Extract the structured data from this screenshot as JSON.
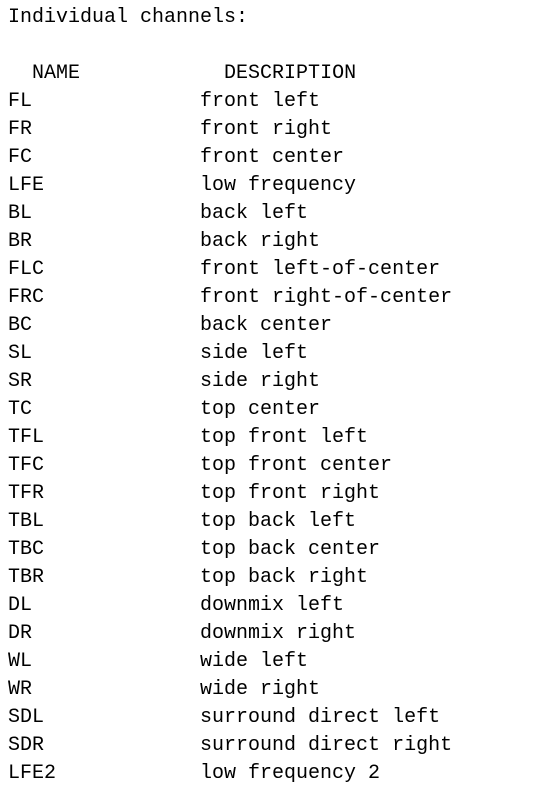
{
  "title": "Individual channels:",
  "header": {
    "name": "NAME",
    "description": "DESCRIPTION"
  },
  "channels": [
    {
      "name": "FL",
      "description": "front left"
    },
    {
      "name": "FR",
      "description": "front right"
    },
    {
      "name": "FC",
      "description": "front center"
    },
    {
      "name": "LFE",
      "description": "low frequency"
    },
    {
      "name": "BL",
      "description": "back left"
    },
    {
      "name": "BR",
      "description": "back right"
    },
    {
      "name": "FLC",
      "description": "front left-of-center"
    },
    {
      "name": "FRC",
      "description": "front right-of-center"
    },
    {
      "name": "BC",
      "description": "back center"
    },
    {
      "name": "SL",
      "description": "side left"
    },
    {
      "name": "SR",
      "description": "side right"
    },
    {
      "name": "TC",
      "description": "top center"
    },
    {
      "name": "TFL",
      "description": "top front left"
    },
    {
      "name": "TFC",
      "description": "top front center"
    },
    {
      "name": "TFR",
      "description": "top front right"
    },
    {
      "name": "TBL",
      "description": "top back left"
    },
    {
      "name": "TBC",
      "description": "top back center"
    },
    {
      "name": "TBR",
      "description": "top back right"
    },
    {
      "name": "DL",
      "description": "downmix left"
    },
    {
      "name": "DR",
      "description": "downmix right"
    },
    {
      "name": "WL",
      "description": "wide left"
    },
    {
      "name": "WR",
      "description": "wide right"
    },
    {
      "name": "SDL",
      "description": "surround direct left"
    },
    {
      "name": "SDR",
      "description": "surround direct right"
    },
    {
      "name": "LFE2",
      "description": "low frequency 2"
    }
  ]
}
